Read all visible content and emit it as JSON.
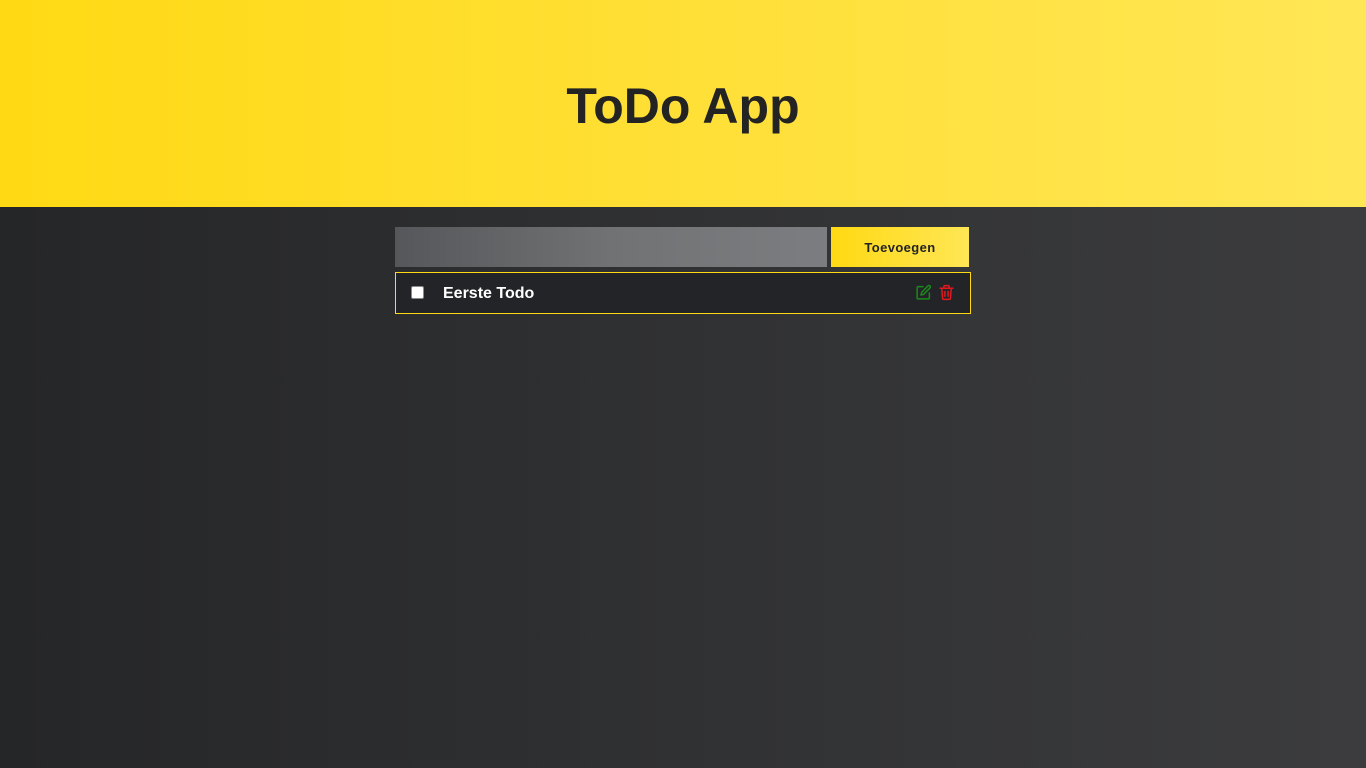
{
  "header": {
    "title": "ToDo App"
  },
  "form": {
    "input_value": "",
    "input_placeholder": "",
    "add_label": "Toevoegen"
  },
  "todos": [
    {
      "text": "Eerste Todo",
      "completed": false,
      "actions": [
        "edit-icon",
        "trash-icon"
      ]
    }
  ],
  "colors": {
    "accent": "#ffd913",
    "edit": "#1a8a1a",
    "delete": "#e0191f",
    "item_border": "#ffd913"
  }
}
